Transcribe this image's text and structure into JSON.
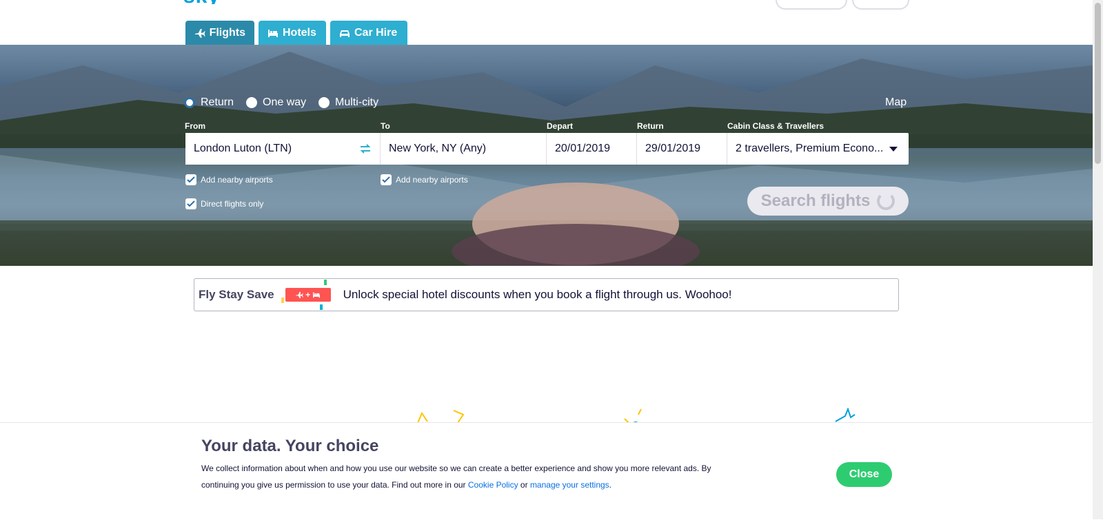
{
  "header": {
    "logo_fragment": "sky"
  },
  "tabs": [
    {
      "label": "Flights",
      "icon": "plane-icon",
      "active": true
    },
    {
      "label": "Hotels",
      "icon": "bed-icon",
      "active": false
    },
    {
      "label": "Car Hire",
      "icon": "car-icon",
      "active": false
    }
  ],
  "search": {
    "trip_types": [
      "Return",
      "One way",
      "Multi-city"
    ],
    "selected_trip_type": "Return",
    "map_link": "Map",
    "labels": {
      "from": "From",
      "to": "To",
      "depart": "Depart",
      "return": "Return",
      "cabin": "Cabin Class & Travellers"
    },
    "values": {
      "from": "London Luton (LTN)",
      "to": "New York, NY (Any)",
      "depart": "20/01/2019",
      "return": "29/01/2019",
      "cabin": "2 travellers, Premium Econo..."
    },
    "checkboxes": {
      "from_nearby": "Add nearby airports",
      "to_nearby": "Add nearby airports",
      "direct_only": "Direct flights only"
    },
    "search_button": "Search flights"
  },
  "promo": {
    "title": "Fly Stay Save",
    "badge": "+",
    "text": "Unlock special hotel discounts when you book a flight through us. Woohoo!"
  },
  "cookie": {
    "title": "Your data. Your choice",
    "text_before": "We collect information about when and how you use our website so we can create a better experience and show you more relevant ads. By continuing you give us permission to use your data. Find out more in our ",
    "link1": "Cookie Policy",
    "text_mid": " or ",
    "link2": "manage your settings",
    "text_after": ".",
    "close_button": "Close"
  },
  "colors": {
    "tab_active": "#2b8aa9",
    "tab": "#2eaed0",
    "accent_link": "#0770e3",
    "close_green": "#2ecc71",
    "promo_badge": "#ff5452"
  }
}
